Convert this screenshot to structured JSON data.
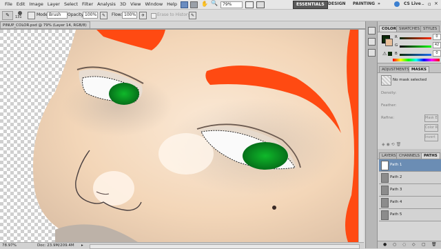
{
  "app": {
    "menus": [
      "File",
      "Edit",
      "Image",
      "Layer",
      "Select",
      "Filter",
      "Analysis",
      "3D",
      "View",
      "Window",
      "Help"
    ],
    "zoom_value": "79%",
    "workspaces": {
      "active": "ESSENTIALS",
      "design": "DESIGN",
      "painting": "PAINTING",
      "more": "»"
    },
    "cs_live": "CS Live"
  },
  "options_bar": {
    "brush_size": "131",
    "mode_label": "Mode:",
    "mode_value": "Brush",
    "opacity_label": "Opacity:",
    "opacity_value": "100%",
    "flow_label": "Flow:",
    "flow_value": "100%",
    "history_label": "Erase to History"
  },
  "document": {
    "tab_title": "PINUP_COLOR.psd @ 79% (Layer 14, RGB/8)",
    "close_glyph": "×"
  },
  "status": {
    "zoom": "78.97%",
    "doc_size": "Doc: 23.9M/209.4M"
  },
  "panels": {
    "color": {
      "tabs": [
        "COLOR",
        "SWATCHES",
        "STYLES"
      ],
      "active_tab": "COLOR",
      "channels": [
        {
          "label": "R",
          "value": "0",
          "color": "#d94a3a"
        },
        {
          "label": "G",
          "value": "42",
          "color": "#3aa04a"
        },
        {
          "label": "B",
          "value": "0",
          "color": "#3a5ad9"
        }
      ],
      "foreground_color": "#0c2a0a"
    },
    "adjust": {
      "tabs": [
        "ADJUSTMENTS",
        "MASKS"
      ],
      "active_tab": "MASKS",
      "no_mask": "No mask selected",
      "density_label": "Density:",
      "feather_label": "Feather:",
      "refine_label": "Refine:",
      "btn_mask_edge": "Mask Edge...",
      "btn_color_range": "Color Range...",
      "btn_invert": "Invert"
    },
    "layers": {
      "tabs": [
        "LAYERS",
        "CHANNELS",
        "PATHS"
      ],
      "active_tab": "PATHS",
      "paths": [
        "Path 1",
        "Path 2",
        "Path 3",
        "Path 4",
        "Path 5"
      ]
    }
  },
  "colors": {
    "hair": "#ff4a12",
    "iris": "#0a9a1e",
    "skin": "#f6dcc2"
  }
}
